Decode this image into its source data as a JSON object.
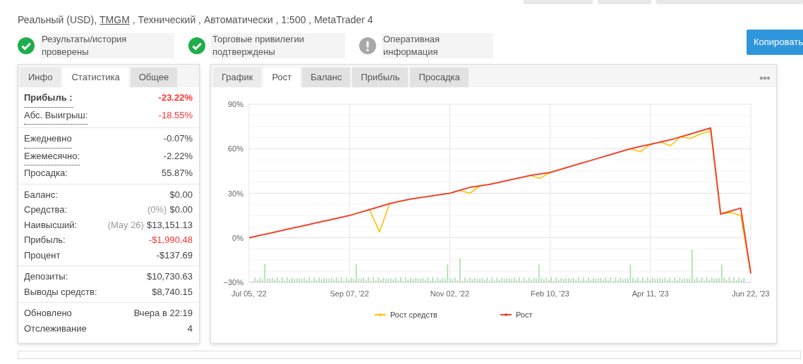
{
  "header": {
    "parts": [
      {
        "kind": "text",
        "text": "Реальный (USD),"
      },
      {
        "kind": "link",
        "text": "TMGM"
      },
      {
        "kind": "text",
        "text": ", Технический , Автоматически , 1:500 , MetaTrader 4"
      }
    ]
  },
  "badges": [
    {
      "kind": "ok",
      "text": "Результаты/история проверены"
    },
    {
      "kind": "ok",
      "text": "Торговые привилегии подтверждены"
    },
    {
      "kind": "info",
      "text": "Оперативная информация"
    }
  ],
  "copy_button": "Копировать",
  "stats_panel": {
    "tabs": [
      {
        "label": "Инфо",
        "selected": false
      },
      {
        "label": "Статистика",
        "selected": true
      },
      {
        "label": "Общее",
        "selected": false
      }
    ],
    "groups": [
      [
        {
          "label": "Прибыль :",
          "value": "-23.22%",
          "hint": true,
          "bold": true,
          "negative": true
        },
        {
          "label": "Абс. Выигрыш:",
          "value": "-18.55%",
          "hint": true,
          "bold": false,
          "negative": true
        }
      ],
      [
        {
          "label": "Ежедневно",
          "value": "-0.07%",
          "hint": true,
          "bold": false,
          "negative": false
        },
        {
          "label": "Ежемесячно:",
          "value": "-2.22%",
          "hint": true,
          "bold": false,
          "negative": false
        },
        {
          "label": "Просадка:",
          "value": "55.87%",
          "hint": false,
          "bold": false,
          "negative": false
        }
      ],
      [
        {
          "label": "Баланс:",
          "value": "$0.00",
          "hint": false,
          "bold": false,
          "negative": false
        },
        {
          "label": "Средства:",
          "note": "(0%)",
          "value": "$0.00",
          "hint": false,
          "bold": false,
          "negative": false
        },
        {
          "label": "Наивысший:",
          "note": "(May 26)",
          "value": "$13,151.13",
          "hint": false,
          "bold": false,
          "negative": false
        },
        {
          "label": "Прибыль:",
          "value": "-$1,990.48",
          "hint": false,
          "bold": false,
          "negative": true
        },
        {
          "label": "Процент",
          "value": "-$137.69",
          "hint": false,
          "bold": false,
          "negative": false
        }
      ],
      [
        {
          "label": "Депозиты:",
          "value": "$10,730.63",
          "hint": false,
          "bold": false,
          "negative": false
        },
        {
          "label": "Выводы средств:",
          "value": "$8,740.15",
          "hint": false,
          "bold": false,
          "negative": false
        }
      ],
      [
        {
          "label": "Обновлено",
          "value": "Вчера в 22:19",
          "hint": false,
          "bold": false,
          "negative": false
        },
        {
          "label": "Отслеживание",
          "value": "4",
          "hint": false,
          "bold": false,
          "negative": false
        }
      ]
    ]
  },
  "chart_panel": {
    "tabs": [
      {
        "label": "График",
        "selected": false
      },
      {
        "label": "Рост",
        "selected": true
      },
      {
        "label": "Баланс",
        "selected": false
      },
      {
        "label": "Прибыль",
        "selected": false
      },
      {
        "label": "Просадка",
        "selected": false
      }
    ],
    "chart_data": {
      "type": "line",
      "categories": [
        "Jul 05, '22",
        null,
        null,
        null,
        null,
        null,
        null,
        null,
        null,
        null,
        "Sep 07, '22",
        null,
        null,
        null,
        null,
        null,
        null,
        null,
        null,
        null,
        "Nov 02, '22",
        null,
        null,
        null,
        null,
        null,
        null,
        null,
        null,
        null,
        "Feb 10, '23",
        null,
        null,
        null,
        null,
        null,
        null,
        null,
        null,
        null,
        "Apr 11, '23",
        null,
        null,
        null,
        null,
        null,
        null,
        null,
        null,
        null,
        "Jun 22, '23"
      ],
      "ylim": [
        -30,
        90
      ],
      "grid": true,
      "legend": "bottom",
      "yticks": [
        {
          "value": 90,
          "label": "90%"
        },
        {
          "value": 60,
          "label": "60%"
        },
        {
          "value": 30,
          "label": "30%"
        },
        {
          "value": 0,
          "label": "0%"
        },
        {
          "value": -30,
          "label": "−30%"
        }
      ],
      "series": [
        {
          "name": "Рост средств",
          "color": "#ffc107",
          "values": [
            null,
            null,
            null,
            null,
            null,
            null,
            null,
            null,
            null,
            null,
            null,
            17,
            19,
            4,
            23,
            null,
            null,
            null,
            null,
            null,
            null,
            32,
            30,
            35,
            null,
            null,
            null,
            null,
            42,
            40,
            44,
            null,
            null,
            null,
            null,
            null,
            null,
            null,
            60,
            58,
            63,
            64.5,
            62,
            68,
            67,
            70,
            72,
            16,
            17,
            15,
            -24
          ]
        },
        {
          "name": "Рост",
          "color": "#f0462d",
          "values": [
            0,
            1.5,
            3,
            4.5,
            6,
            7.5,
            9,
            10.5,
            12,
            13.5,
            15,
            17,
            19,
            21,
            23,
            24.5,
            26,
            27,
            28,
            29,
            30,
            32,
            34,
            35,
            36,
            37.5,
            39,
            40.5,
            42,
            43,
            44,
            46,
            48,
            50,
            52,
            54,
            56,
            58,
            60,
            61.5,
            63,
            64.5,
            66,
            68,
            70,
            72,
            74,
            16,
            18,
            20,
            -24
          ]
        }
      ]
    }
  }
}
